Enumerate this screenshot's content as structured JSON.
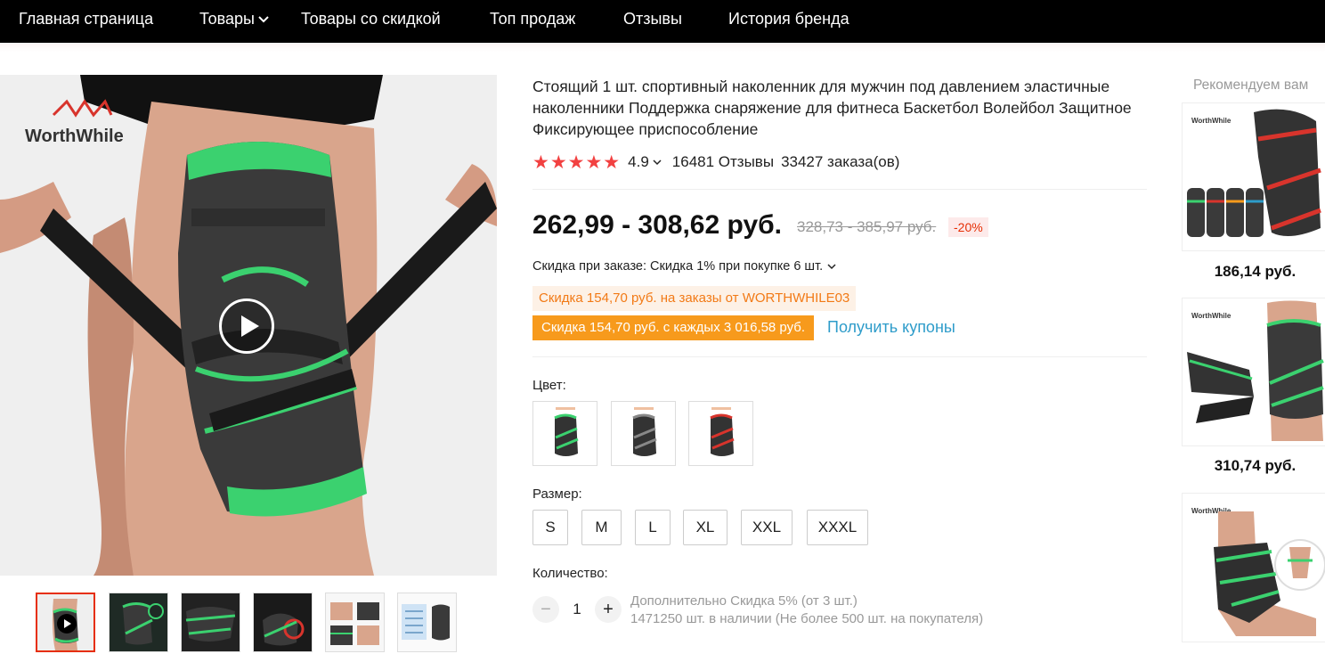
{
  "nav": {
    "items": [
      "Главная страница",
      "Товары",
      "Товары со скидкой",
      "Топ продаж",
      "Отзывы",
      "История бренда"
    ]
  },
  "gallery": {
    "brand_logo_text": "WorthWhile",
    "thumbnail_count": 6
  },
  "product": {
    "title": "Стоящий 1 шт. спортивный наколенник для мужчин под давлением эластичные наколенники Поддержка снаряжение для фитнеса Баскетбол Волейбол Защитное Фиксирующее приспособление",
    "stars": "★★★★★",
    "rating": "4.9",
    "reviews": "16481 Отзывы",
    "orders": "33427 заказа(ов)",
    "price": "262,99 - 308,62 руб.",
    "old_price": "328,73 - 385,97 руб.",
    "discount_pct": "-20%",
    "bulk_discount": "Скидка при заказе: Скидка 1% при покупке 6 шт.",
    "coupon_store": "Скидка 154,70 руб. на заказы от WORTHWHILE03",
    "coupon_every": "Скидка 154,70 руб. с каждых 3 016,58 руб.",
    "get_coupons": "Получить купоны",
    "color_label": "Цвет:",
    "colors": [
      {
        "name": "green",
        "accent": "#3bd16f"
      },
      {
        "name": "gray",
        "accent": "#777777"
      },
      {
        "name": "red",
        "accent": "#d8342c"
      }
    ],
    "size_label": "Размер:",
    "sizes": [
      "S",
      "M",
      "L",
      "XL",
      "XXL",
      "XXXL"
    ],
    "quantity_label": "Количество:",
    "quantity": "1",
    "qty_minus": "−",
    "qty_plus": "+",
    "extra_discount": "Дополнительно Скидка 5% (от 3 шт.)",
    "stock": "1471250 шт. в наличии (Не более 500 шт. на покупателя)"
  },
  "recommend": {
    "title": "Рекомендуем вам",
    "items": [
      {
        "price": "186,14 руб."
      },
      {
        "price": "310,74 руб."
      }
    ]
  },
  "colors": {
    "nav_bg": "#000000",
    "accent_red": "#e62e04",
    "star": "#f24141",
    "coupon_orange": "#f79a1c",
    "link_blue": "#2e9cca",
    "brace_green": "#3bd16f"
  }
}
